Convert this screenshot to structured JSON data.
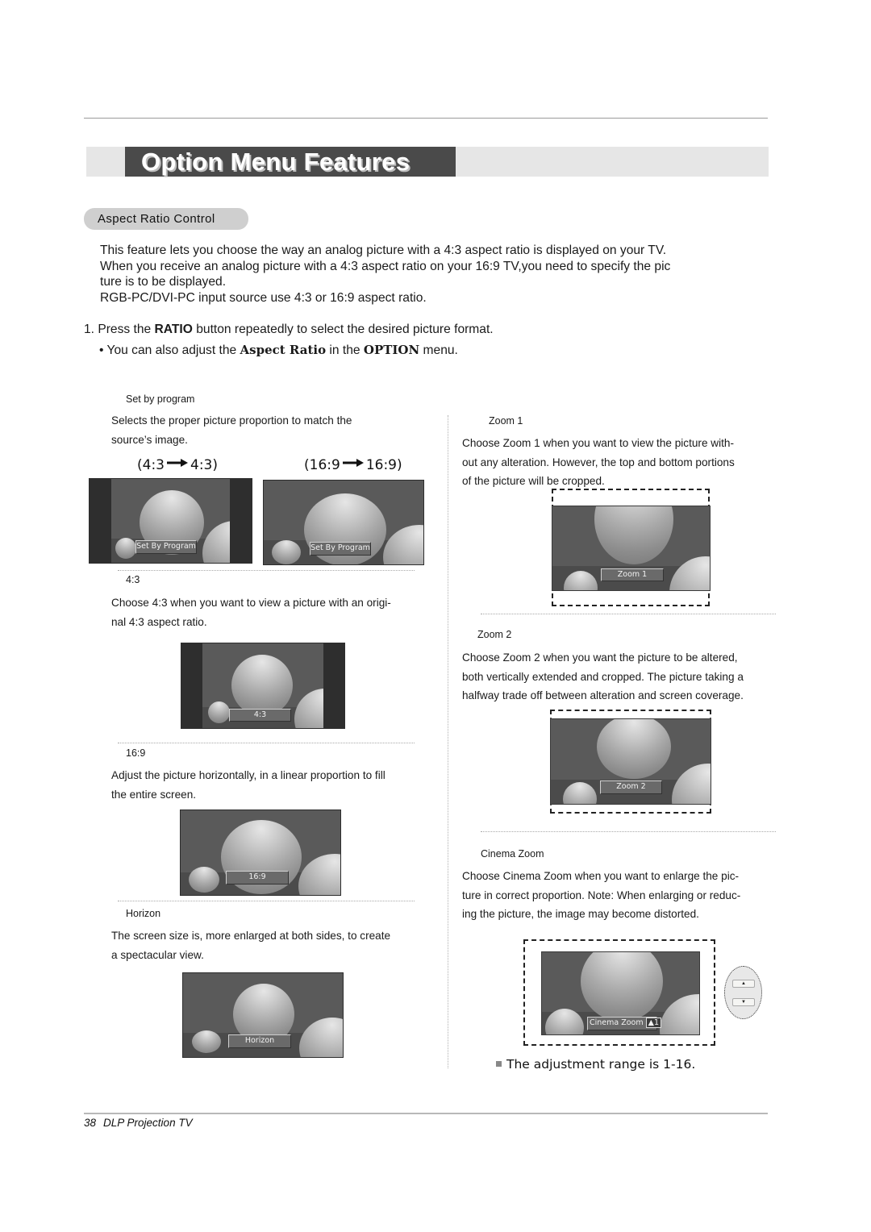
{
  "page": {
    "title": "Option Menu Features",
    "section": "Aspect Ratio Control",
    "intro_lines": [
      "This feature lets you choose the way an analog picture with a 4:3 aspect ratio is displayed on your TV.",
      "When you receive an analog picture with a 4:3 aspect ratio on your 16:9 TV,you need to specify the pic",
      "ture is to be displayed.",
      "RGB-PC/DVI-PC input source use 4:3 or 16:9 aspect ratio."
    ],
    "step": {
      "prefix": "1. Press the ",
      "key": "RATIO",
      "suffix": " button repeatedly to select the desired picture format."
    },
    "bullet": {
      "prefix": "• You can also adjust the ",
      "item": "Aspect Ratio",
      "middle": " in the ",
      "menu": "OPTION",
      "suffix": " menu."
    }
  },
  "modes": {
    "set_by_program": {
      "heading": "Set by program",
      "desc_lines": [
        "Selects the proper picture proportion to match the",
        "source’s image."
      ],
      "ratio_a": "(4:3",
      "ratio_a2": "4:3)",
      "ratio_b": "(16:9",
      "ratio_b2": "16:9)",
      "osd": "Set By Program"
    },
    "r43": {
      "heading": "4:3",
      "desc_lines": [
        "Choose 4:3 when you want to view a picture with an origi-",
        "nal 4:3 aspect ratio."
      ],
      "osd": "4:3"
    },
    "r169": {
      "heading": "16:9",
      "desc_lines": [
        "Adjust the picture horizontally, in a linear proportion to fill",
        "the entire screen."
      ],
      "osd": "16:9"
    },
    "horizon": {
      "heading": "Horizon",
      "desc_lines": [
        "The screen size is, more enlarged at both sides, to create",
        "a spectacular view."
      ],
      "osd": "Horizon"
    },
    "zoom1": {
      "heading": "Zoom 1",
      "desc_lines": [
        "Choose Zoom 1 when you want to view the picture with-",
        "out any alteration. However, the top and bottom portions",
        "of the picture will be cropped."
      ],
      "osd": "Zoom 1"
    },
    "zoom2": {
      "heading": "Zoom 2",
      "desc_lines": [
        "Choose Zoom 2 when you want the picture to be altered,",
        "both vertically extended and cropped. The picture taking a",
        "halfway trade off between alteration and screen coverage."
      ],
      "osd": "Zoom 2"
    },
    "cinema_zoom": {
      "heading": "Cinema Zoom",
      "desc_lines": [
        "Choose Cinema Zoom when you want to enlarge the pic-",
        "ture in correct proportion. Note: When enlarging or reduc-",
        "ing the picture, the image may become distorted."
      ],
      "osd": "Cinema Zoom",
      "osd_value": "▲1",
      "up_icon": "▲",
      "down_icon": "▼"
    }
  },
  "note": "The adjustment range is 1-16.",
  "footer": {
    "page_number": "38",
    "title": "DLP Projection TV"
  },
  "icons": {
    "arrow": "arrow-right-icon"
  }
}
